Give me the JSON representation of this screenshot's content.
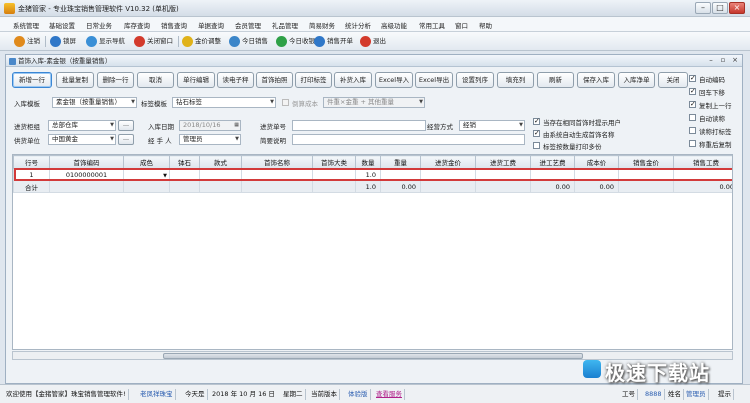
{
  "window": {
    "title": "金猪管家 - 专业珠宝销售管理软件 V10.32 (单机版)"
  },
  "menu": [
    "系统管理",
    "基础设置",
    "日常业务",
    "库存查询",
    "销售查询",
    "单据查询",
    "会员管理",
    "礼品管理",
    "简易财务",
    "统计分析",
    "高级功能",
    "常用工具",
    "窗口",
    "帮助"
  ],
  "toolbar": [
    {
      "label": "注销",
      "icon": "logout-icon",
      "color": "#e08a1c"
    },
    {
      "label": "锁屏",
      "icon": "lock-icon",
      "color": "#2f77c8"
    },
    {
      "label": "显示导航",
      "icon": "navigation-icon",
      "color": "#3a8fd6"
    },
    {
      "label": "关闭窗口",
      "icon": "close-window-icon",
      "color": "#d33a2c"
    },
    {
      "label": "金价调整",
      "icon": "gold-price-icon",
      "color": "#e0b21a"
    },
    {
      "label": "今日销售",
      "icon": "today-sales-icon",
      "color": "#3c86c9"
    },
    {
      "label": "今日收银",
      "icon": "today-cashier-icon",
      "color": "#2ea047"
    },
    {
      "label": "销售开单",
      "icon": "sales-order-icon",
      "color": "#2f77c8"
    },
    {
      "label": "退出",
      "icon": "exit-icon",
      "color": "#d33a2c"
    }
  ],
  "subwindow": {
    "title": "首饰入库-素金银（按重量销售）"
  },
  "actions": [
    "新增一行",
    "批量复制",
    "删除一行",
    "取消",
    "单行编辑",
    "读电子秤",
    "首饰拍照",
    "打印标签",
    "补货入库",
    "Excel导入",
    "Excel导出",
    "设置列序",
    "填充列",
    "刷新",
    "保存入库",
    "入库净单",
    "关闭"
  ],
  "form": {
    "template_label": "入库模板",
    "template_value": "素金银（按重量销售）",
    "tag_template_label": "标签模板",
    "tag_template_value": "钻石标签",
    "cost_label": "倒算成本",
    "cost_value": "件重×金重 + 其他重量",
    "group_label": "进货柜组",
    "group_value": "总部仓库",
    "date_label": "入库日期",
    "date_value": "2018/10/16",
    "receipt_label": "进货单号",
    "receipt_value": "",
    "method_label": "经营方式",
    "method_value": "经销",
    "supplier_label": "供货单位",
    "supplier_value": "中国黄金",
    "handler_label": "经 手 人",
    "handler_value": "管理员",
    "note_label": "简要说明",
    "note_value": ""
  },
  "options": [
    {
      "label": "当存在相同首饰时提示用户",
      "checked": true
    },
    {
      "label": "由系统自动生成首饰名称",
      "checked": true
    },
    {
      "label": "标签按数量打印多份",
      "checked": false
    }
  ],
  "side_options": [
    {
      "label": "自动编码",
      "checked": true
    },
    {
      "label": "回车下移",
      "checked": true
    },
    {
      "label": "复制上一行",
      "checked": true
    },
    {
      "label": "自动读称",
      "checked": false
    },
    {
      "label": "读称打标签",
      "checked": false
    },
    {
      "label": "称重后复制",
      "checked": false
    }
  ],
  "grid": {
    "columns": [
      "行号",
      "首饰编码",
      "成色",
      "钵石",
      "款式",
      "首饰名称",
      "首饰大类",
      "数量",
      "重量",
      "进货金价",
      "进货工费",
      "进工艺费",
      "成本价",
      "销售金价",
      "销售工费"
    ],
    "rows": [
      [
        "1",
        "0100000001",
        "",
        "",
        "",
        "",
        "",
        "1.0",
        "",
        "",
        "",
        "",
        "",
        "",
        ""
      ]
    ],
    "total_row": [
      "合计",
      "",
      "",
      "",
      "",
      "",
      "",
      "1.0",
      "0.00",
      "",
      "",
      "0.00",
      "0.00",
      "",
      "0.00"
    ]
  },
  "status": {
    "welcome": "欢迎使用【金猪管家】珠宝销售管理软件!",
    "store": "老凤祥珠宝",
    "today_prefix": "今天是",
    "date": "2018 年 10 月 16 日",
    "weekday": "星期二",
    "version_label": "当前版本",
    "version_value": "体验版",
    "service_link": "查看服务",
    "job_no_label": "工号",
    "job_no_value": "8888",
    "name_label": "姓名",
    "name_value": "管理员",
    "tip": "提示"
  },
  "watermark": "极速下载站"
}
